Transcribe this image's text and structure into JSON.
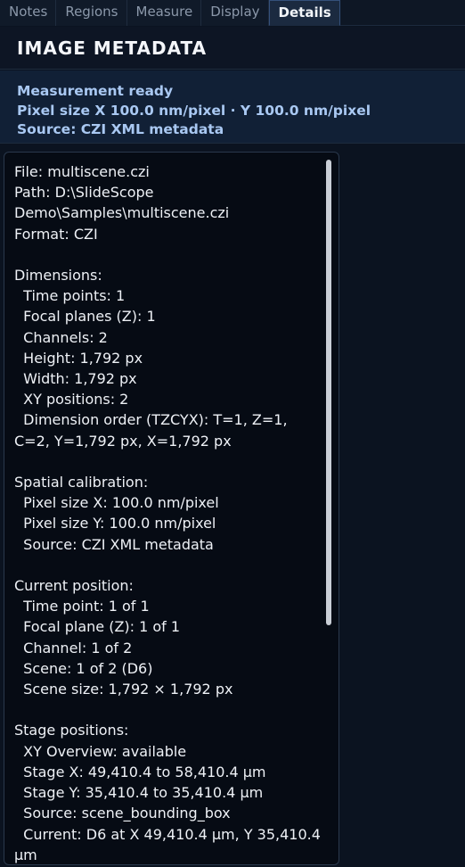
{
  "tabs": [
    {
      "label": "Notes"
    },
    {
      "label": "Regions"
    },
    {
      "label": "Measure"
    },
    {
      "label": "Display"
    },
    {
      "label": "Details"
    }
  ],
  "active_tab": "Details",
  "header": {
    "title": "IMAGE METADATA"
  },
  "status": {
    "line1": "Measurement ready",
    "line2": "Pixel size X 100.0 nm/pixel · Y 100.0 nm/pixel",
    "line3": "Source: CZI XML metadata"
  },
  "metadata_text": "File: multiscene.czi\nPath: D:\\SlideScope Demo\\Samples\\multiscene.czi\nFormat: CZI\n\nDimensions:\n  Time points: 1\n  Focal planes (Z): 1\n  Channels: 2\n  Height: 1,792 px\n  Width: 1,792 px\n  XY positions: 2\n  Dimension order (TZCYX): T=1, Z=1, C=2, Y=1,792 px, X=1,792 px\n\nSpatial calibration:\n  Pixel size X: 100.0 nm/pixel\n  Pixel size Y: 100.0 nm/pixel\n  Source: CZI XML metadata\n\nCurrent position:\n  Time point: 1 of 1\n  Focal plane (Z): 1 of 1\n  Channel: 1 of 2\n  Scene: 1 of 2 (D6)\n  Scene size: 1,792 × 1,792 px\n\nStage positions:\n  XY Overview: available\n  Stage X: 49,410.4 to 58,410.4 µm\n  Stage Y: 35,410.4 to 35,410.4 µm\n  Source: scene_bounding_box\n  Current: D6 at X 49,410.4 µm, Y 35,410.4 µm"
}
